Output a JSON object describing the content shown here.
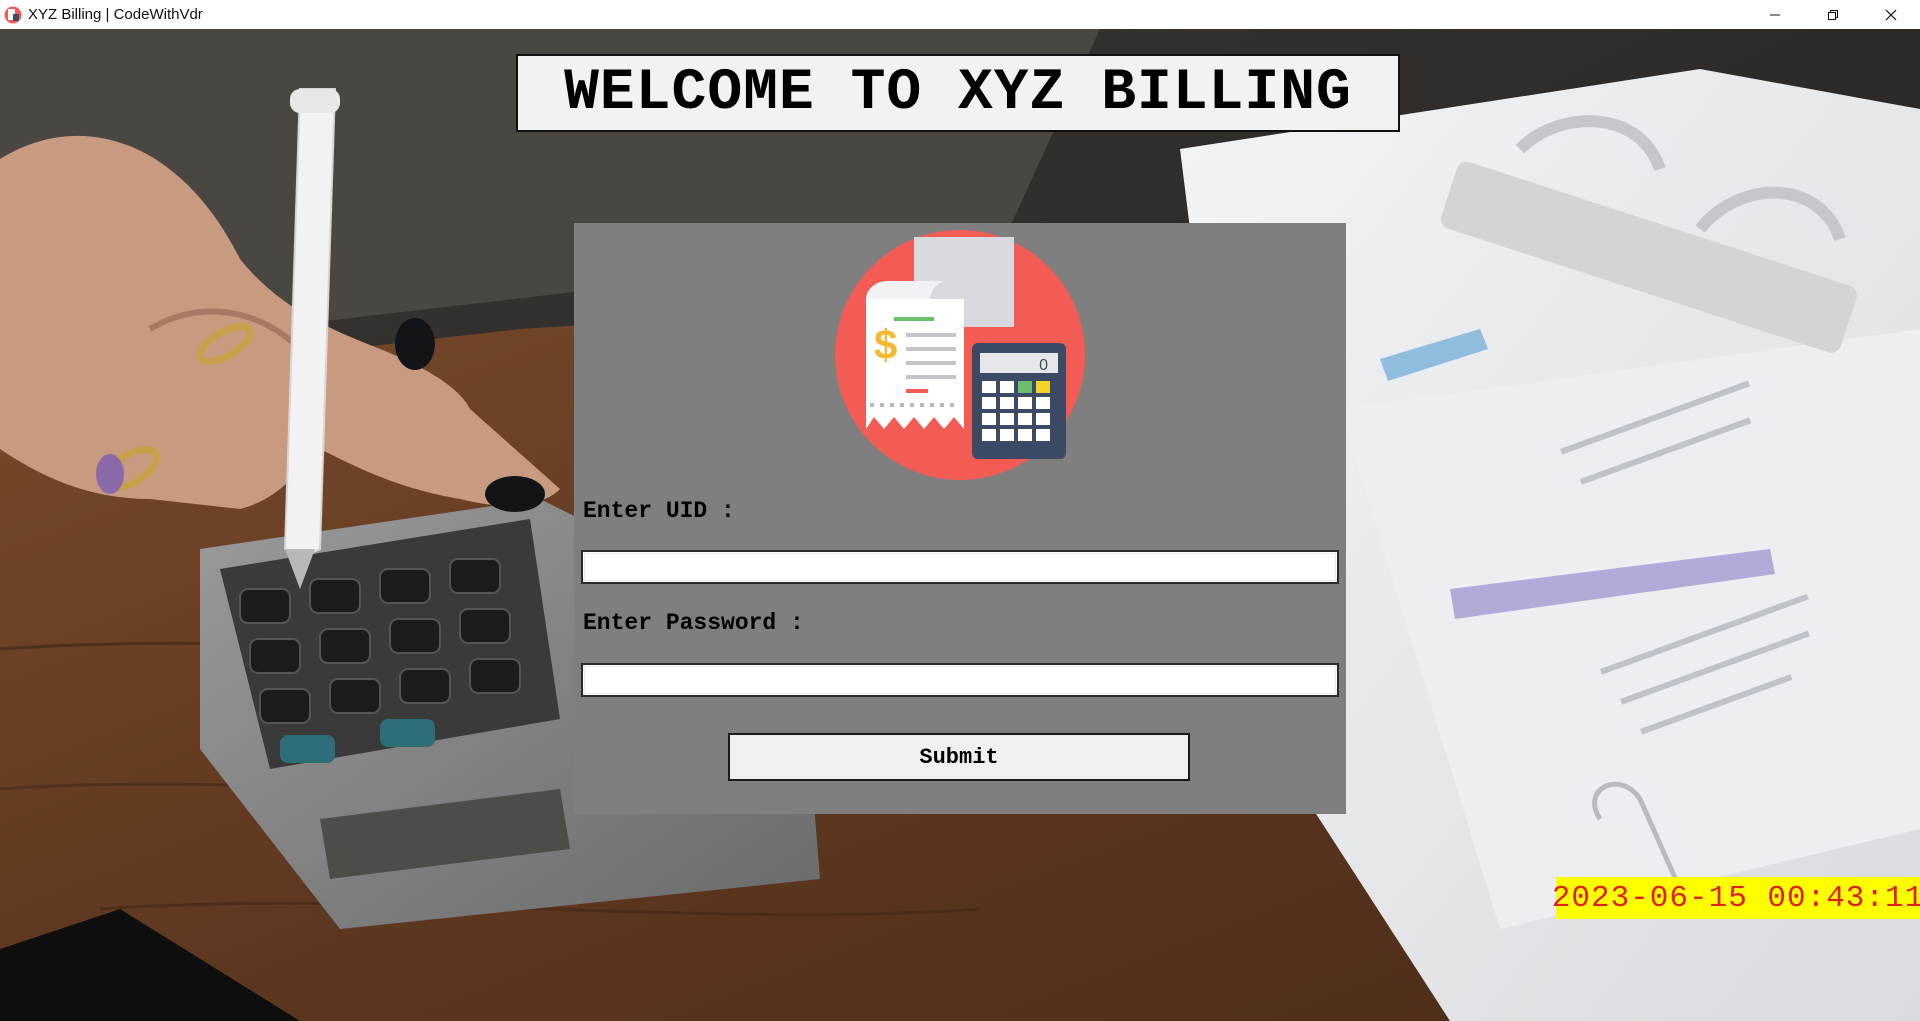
{
  "window": {
    "title": "XYZ Billing | CodeWithVdr",
    "icon": "receipt-app-icon",
    "controls": [
      "minimize-icon",
      "restore-icon",
      "close-icon"
    ]
  },
  "banner": {
    "text": "WELCOME TO XYZ BILLING"
  },
  "login": {
    "logo_icon": "receipt-calculator-icon",
    "calculator_display": "0",
    "uid_label": "Enter UID :",
    "uid_value": "",
    "password_label": "Enter Password :",
    "password_value": "",
    "submit_label": "Submit"
  },
  "clock": {
    "datetime": "2023-06-15 00:43:11"
  },
  "colors": {
    "panel": "#7f7f7f",
    "clock_bg": "#ffff00",
    "clock_text": "#e0201e",
    "logo_circle": "#f25c54"
  }
}
